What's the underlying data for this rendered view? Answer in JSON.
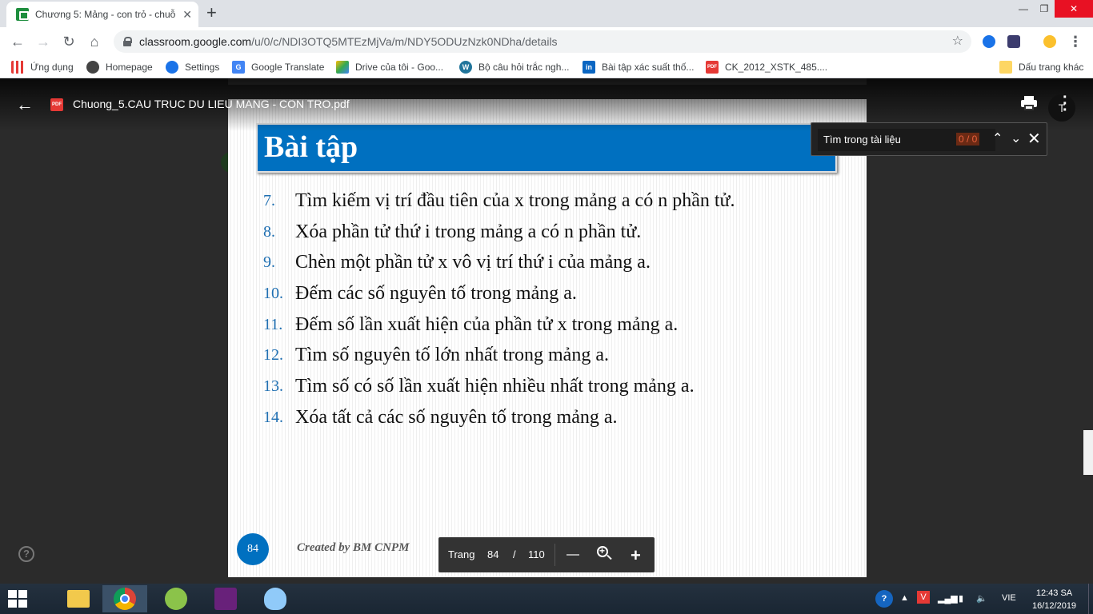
{
  "browser": {
    "tab_title": "Chương 5: Mảng - con trỏ - chuỗ",
    "tab_close": "✕",
    "new_tab": "+",
    "url_host": "classroom.google.com",
    "url_path": "/u/0/c/NDI3OTQ5MTEzMjVa/m/NDY5ODUzNzk0NDha/details",
    "window_min": "—",
    "window_max": "❐",
    "window_close": "✕"
  },
  "bookmarks": [
    {
      "label": "Ứng dụng",
      "icon": "apps-grid-icon"
    },
    {
      "label": "Homepage",
      "icon": "globe-icon"
    },
    {
      "label": "Settings",
      "icon": "gear-icon"
    },
    {
      "label": "Google Translate",
      "icon": "translate-icon"
    },
    {
      "label": "Drive của tôi - Goo...",
      "icon": "drive-icon"
    },
    {
      "label": "Bộ câu hỏi trắc ngh...",
      "icon": "wordpress-icon"
    },
    {
      "label": "Bài tập xác suất thố...",
      "icon": "linkedin-icon"
    },
    {
      "label": "CK_2012_XSTK_485....",
      "icon": "pdf-icon"
    }
  ],
  "other_bookmarks": "Dấu trang khác",
  "viewer": {
    "file_name": "Chuong_5.CAU TRUC DU LIEU MANG - CON TRO.pdf",
    "file_badge": "PDF",
    "avatar_letter": "T",
    "help": "?"
  },
  "slide": {
    "title": "Bài tập",
    "items": [
      {
        "num": "7.",
        "text": "Tìm kiếm vị trí đầu tiên của x trong mảng a có n phần tử."
      },
      {
        "num": "8.",
        "text": "Xóa phần tử thứ i trong mảng a có n phần tử."
      },
      {
        "num": "9.",
        "text": "Chèn một phần tử x vô vị trí thứ  i của mảng a."
      },
      {
        "num": "10.",
        "text": "Đếm các số nguyên tố trong mảng a."
      },
      {
        "num": "11.",
        "text": "Đếm số lần xuất hiện của phần tử x trong mảng a."
      },
      {
        "num": "12.",
        "text": "Tìm số nguyên tố lớn nhất trong mảng a."
      },
      {
        "num": "13.",
        "text": "Tìm số có số lần xuất hiện nhiều nhất trong mảng a."
      },
      {
        "num": "14.",
        "text": "Xóa tất cả các số nguyên tố trong mảng a."
      }
    ],
    "page_number": "84",
    "footer": "Created by BM CNPM"
  },
  "page_control": {
    "label": "Trang",
    "current": "84",
    "separator": "/",
    "total": "110"
  },
  "find": {
    "placeholder": "Tìm trong tài liệu",
    "count": "0 / 0"
  },
  "taskbar": {
    "lang": "VIE",
    "time": "12:43 SA",
    "date": "16/12/2019"
  }
}
